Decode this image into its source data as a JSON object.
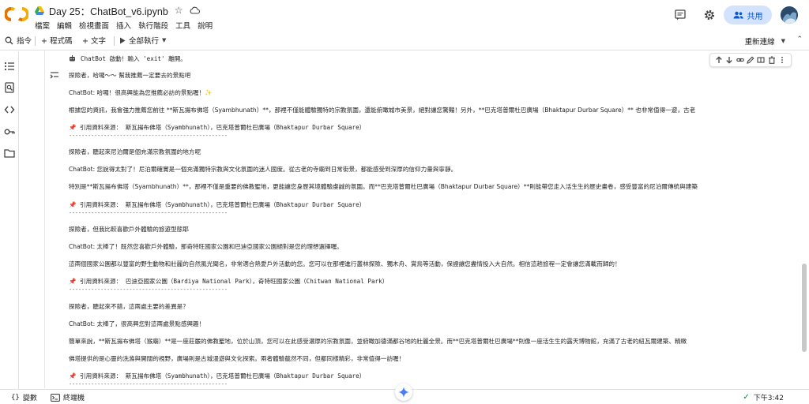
{
  "header": {
    "title": "Day 25：ChatBot_v6.ipynb",
    "menus": [
      "檔案",
      "編輯",
      "檢視畫面",
      "插入",
      "執行階段",
      "工具",
      "說明"
    ],
    "share_label": "共用",
    "logo_text": "CO"
  },
  "toolbar": {
    "commands": "指令",
    "add_code": "+ 程式碼",
    "add_text": "+ 文字",
    "run_all": "全部執行",
    "reconnect": "重新連線"
  },
  "output": {
    "start_line": "ChatBot 啟動！輸入 'exit' 離開。",
    "lines": [
      "探險者，哈囉～～ 幫我推薦一定要去的景點吧",
      "ChatBot: 哈囉！很高興能為您推薦必訪的景點喔！✨",
      "根據您的資訊，我會強力推薦您前往 **斯瓦揚布佛塔（Syambhunath）**，那裡不僅能體驗獨特的宗教氛圍，還能俯瞰城市美景，絕對讓您驚豔！另外，**巴克塔普爾杜巴廣場（Bhaktapur Durbar Square）** 也非常值得一遊，古老",
      "📌 引用資料來源： 斯瓦揚布佛塔（Syambhunath），巴克塔普爾杜巴廣場（Bhaktapur Durbar Square）",
      "--------------------------------------------------",
      "探險者，聽起來尼泊爾是個充滿宗教氛圍的地方呢",
      "ChatBot: 您說得太對了！尼泊爾確實是一個充滿獨特宗教與文化氛圍的迷人國度。從古老的寺廟到日常街景，都能感受到深厚的信仰力量與寧靜。",
      "特別是**斯瓦揚布佛塔（Syambhunath）**，那裡不僅是重要的佛教聖地，更能讓您身歷其境體驗虔誠的氛圍。而**巴克塔普爾杜巴廣場（Bhaktapur Durbar Square）**則能帶您走入活生生的歷史畫卷，感受豐富的尼泊爾傳統與建築",
      "📌 引用資料來源： 斯瓦揚布佛塔（Syambhunath），巴克塔普爾杜巴廣場（Bhaktapur Durbar Square）",
      "--------------------------------------------------",
      "探險者，但我比較喜歡戶外體驗的旅遊型態耶",
      "ChatBot: 太棒了！既然您喜歡戶外體驗，那奇特旺國家公園和巴迪亞國家公園絕對是您的理想選擇喔。",
      "這兩個國家公園都以豐富的野生動物和壯麗的自然風光聞名，非常適合熱愛戶外活動的您。您可以在那裡進行叢林探險、獨木舟、賞鳥等活動，保證讓您盡情投入大自然。相信這趟旅程一定會讓您滿載而歸的！",
      "📌 引用資料來源： 巴迪亞國家公園（Bardiya National Park），奇特旺國家公園（Chitwan National Park）",
      "--------------------------------------------------",
      "探險者，聽起來不錯，這兩處主要的差異是？",
      "ChatBot: 太棒了，很高興您對這兩處景點感興趣！",
      "簡單來說，**斯瓦揚布佛塔（猴廟）**是一座莊嚴的佛教聖地，位於山頂，您可以在此感受濃厚的宗教氛圍，並俯瞰加德滿都谷地的壯麗全景。而**巴克塔普爾杜巴廣場**則像一座活生生的露天博物館，充滿了古老的紐瓦爾建築、精緻",
      "佛塔提供的是心靈的洗滌與開闊的視野，廣場則是古城漫遊與文化探索。兩者體驗截然不同，但都同樣精彩，非常值得一訪喔！",
      "📌 引用資料來源： 斯瓦揚布佛塔（Syambhunath），巴克塔普爾杜巴廣場（Bhaktapur Durbar Square）",
      "--------------------------------------------------"
    ]
  },
  "statusbar": {
    "variables": "變數",
    "terminal": "終端機",
    "time": "下午3:42"
  },
  "colors": {
    "accent": "#0b57d0",
    "share_bg": "#d3e3fd",
    "pin": "#d93025",
    "logo_orange": "#f9ab00",
    "logo_dark_orange": "#e37400"
  }
}
